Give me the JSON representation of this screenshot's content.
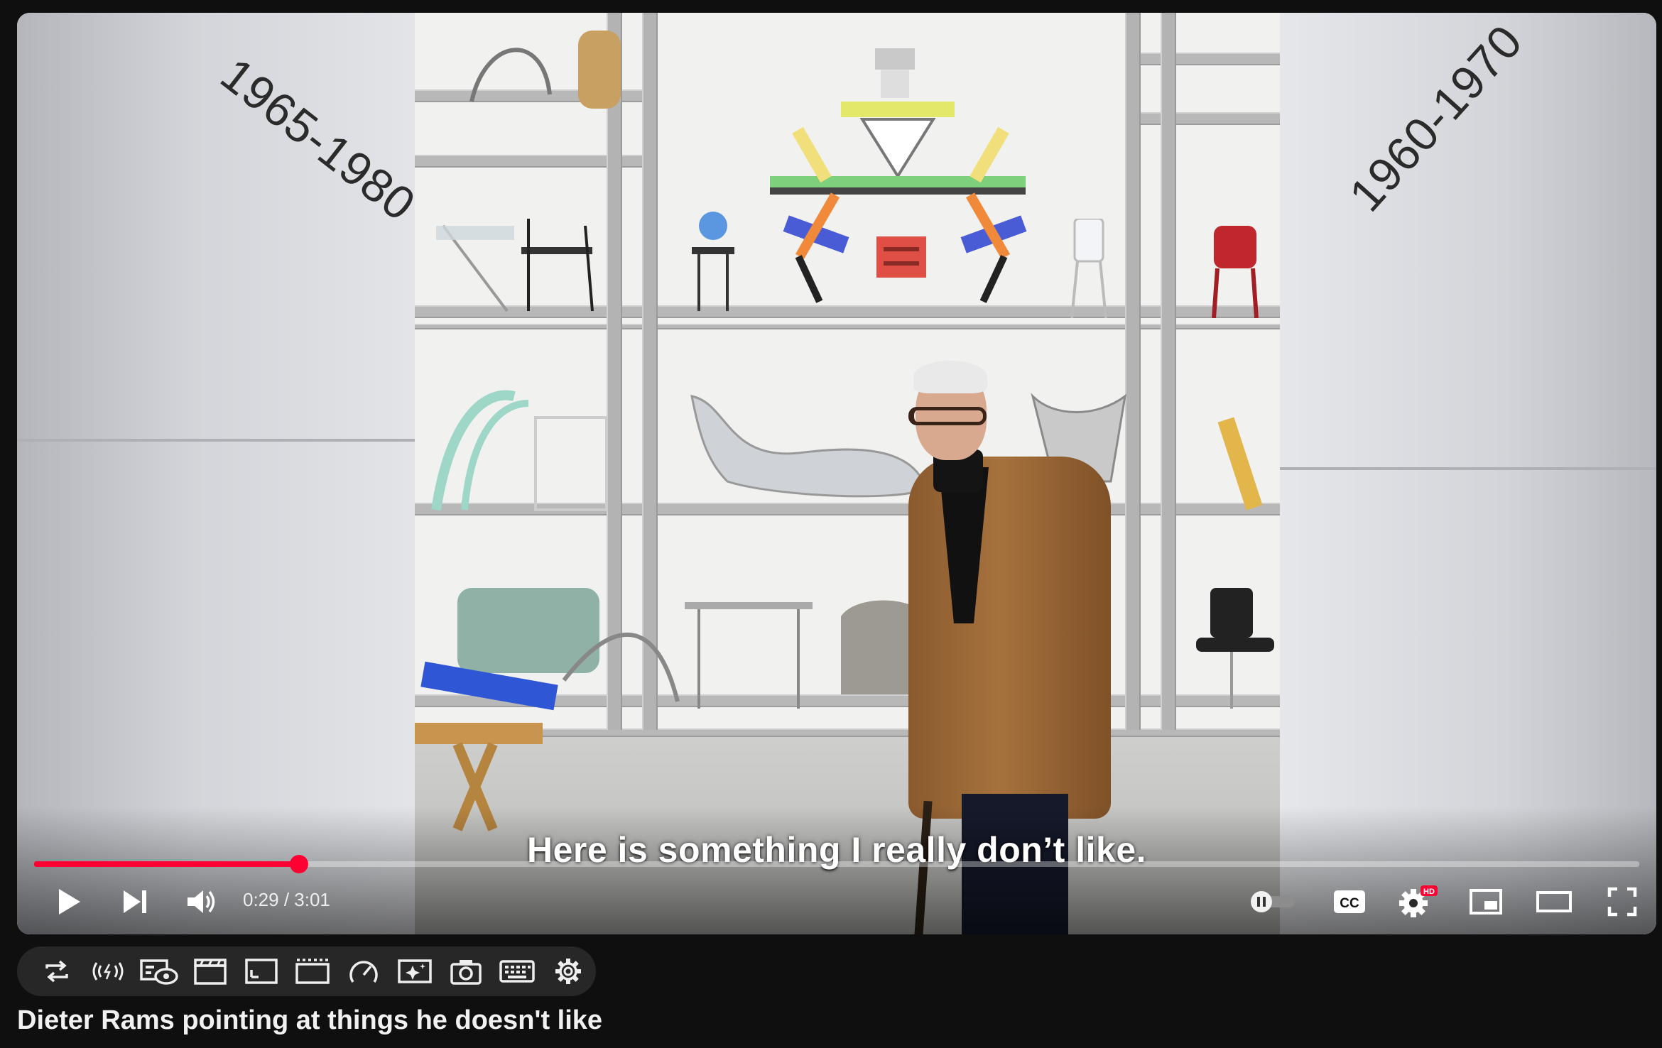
{
  "video": {
    "title": "Dieter Rams pointing at things he doesn't like",
    "subtitle": "Here is something I really don’t like.",
    "scene_labels": {
      "left": "1965-1980",
      "right": "1960-1970"
    }
  },
  "player": {
    "current_time": "0:29",
    "separator": " / ",
    "duration": "3:01",
    "progress": 0.165,
    "accent_color": "#ff0033",
    "settings_badge": "HD",
    "controls": [
      {
        "name": "play-button",
        "icon": "play-icon"
      },
      {
        "name": "next-button",
        "icon": "skip-next-icon"
      },
      {
        "name": "volume-button",
        "icon": "volume-icon"
      },
      {
        "name": "autoplay-toggle",
        "icon": "toggle-pause-icon"
      },
      {
        "name": "captions-button",
        "icon": "cc-icon"
      },
      {
        "name": "settings-button",
        "icon": "gear-icon"
      },
      {
        "name": "miniplayer-button",
        "icon": "miniplayer-icon"
      },
      {
        "name": "theater-button",
        "icon": "theater-icon"
      },
      {
        "name": "fullscreen-button",
        "icon": "fullscreen-icon"
      }
    ]
  },
  "toolbar": {
    "buttons": [
      "loop-icon",
      "live-broadcast-icon",
      "watch-list-icon",
      "clapperboard-icon",
      "crop-icon",
      "frame-icon",
      "speedometer-icon",
      "sparkle-screen-icon",
      "camera-icon",
      "keyboard-icon",
      "gear-icon"
    ]
  }
}
